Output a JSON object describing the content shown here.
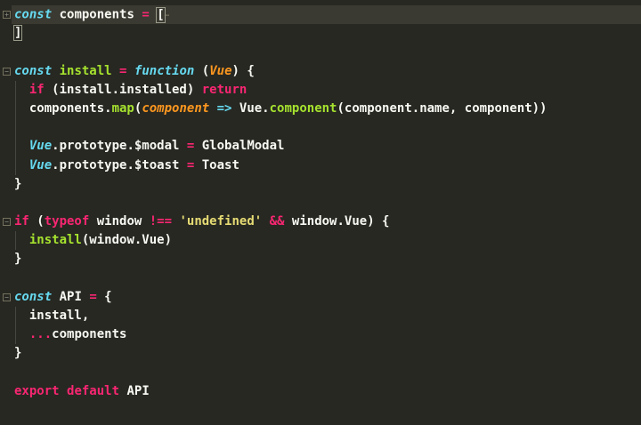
{
  "editor": {
    "lines": [
      {
        "fold": "plus",
        "current": true,
        "tokens": [
          [
            "const",
            "st"
          ],
          [
            " components ",
            ""
          ],
          [
            "=",
            "kw"
          ],
          [
            " ",
            ""
          ],
          [
            "[",
            "br"
          ],
          [
            "…",
            "ell"
          ]
        ]
      },
      {
        "tokens": [
          [
            "]",
            "br"
          ]
        ]
      },
      {
        "tokens": []
      },
      {
        "fold": "minus",
        "tokens": [
          [
            "const",
            "st"
          ],
          [
            " ",
            ""
          ],
          [
            "install",
            "fn"
          ],
          [
            " ",
            ""
          ],
          [
            "=",
            "kw"
          ],
          [
            " ",
            ""
          ],
          [
            "function",
            "st"
          ],
          [
            " (",
            ""
          ],
          [
            "Vue",
            "pa"
          ],
          [
            ") {",
            ""
          ]
        ]
      },
      {
        "guide": true,
        "tokens": [
          [
            "  ",
            ""
          ],
          [
            "if",
            "kw"
          ],
          [
            " (install.installed) ",
            ""
          ],
          [
            "return",
            "kw"
          ]
        ]
      },
      {
        "guide": true,
        "tokens": [
          [
            "  components.",
            ""
          ],
          [
            "map",
            "fn"
          ],
          [
            "(",
            ""
          ],
          [
            "component",
            "pa"
          ],
          [
            " ",
            ""
          ],
          [
            "=>",
            "op2"
          ],
          [
            " Vue.",
            ""
          ],
          [
            "component",
            "fn"
          ],
          [
            "(component.name, component))",
            ""
          ]
        ]
      },
      {
        "guide": true,
        "tokens": []
      },
      {
        "guide": true,
        "tokens": [
          [
            "  ",
            ""
          ],
          [
            "Vue",
            "st"
          ],
          [
            ".prototype.$modal ",
            ""
          ],
          [
            "=",
            "kw"
          ],
          [
            " GlobalModal",
            ""
          ]
        ]
      },
      {
        "guide": true,
        "tokens": [
          [
            "  ",
            ""
          ],
          [
            "Vue",
            "st"
          ],
          [
            ".prototype.$toast ",
            ""
          ],
          [
            "=",
            "kw"
          ],
          [
            " Toast",
            ""
          ]
        ]
      },
      {
        "tokens": [
          [
            "}",
            ""
          ]
        ]
      },
      {
        "tokens": []
      },
      {
        "fold": "minus",
        "tokens": [
          [
            "if",
            "kw"
          ],
          [
            " (",
            ""
          ],
          [
            "typeof",
            "kw"
          ],
          [
            " window ",
            ""
          ],
          [
            "!==",
            "kw"
          ],
          [
            " ",
            ""
          ],
          [
            "'undefined'",
            "str"
          ],
          [
            " ",
            ""
          ],
          [
            "&&",
            "kw"
          ],
          [
            " window.Vue) {",
            ""
          ]
        ]
      },
      {
        "guide": true,
        "tokens": [
          [
            "  ",
            ""
          ],
          [
            "install",
            "fn"
          ],
          [
            "(window.Vue)",
            ""
          ]
        ]
      },
      {
        "tokens": [
          [
            "}",
            ""
          ]
        ]
      },
      {
        "tokens": []
      },
      {
        "fold": "minus",
        "tokens": [
          [
            "const",
            "st"
          ],
          [
            " API ",
            ""
          ],
          [
            "=",
            "kw"
          ],
          [
            " {",
            ""
          ]
        ]
      },
      {
        "guide": true,
        "tokens": [
          [
            "  install,",
            ""
          ]
        ]
      },
      {
        "guide": true,
        "tokens": [
          [
            "  ",
            ""
          ],
          [
            "...",
            "kw"
          ],
          [
            "components",
            ""
          ]
        ]
      },
      {
        "tokens": [
          [
            "}",
            ""
          ]
        ]
      },
      {
        "tokens": []
      },
      {
        "tokens": [
          [
            "export",
            "kw"
          ],
          [
            " ",
            ""
          ],
          [
            "default",
            "kw"
          ],
          [
            " API",
            ""
          ]
        ]
      }
    ]
  },
  "colors": {
    "background": "#272822",
    "keyword": "#f92672",
    "storage": "#66d9ef",
    "function": "#a6e22e",
    "parameter": "#fd971f",
    "string": "#e6db74"
  }
}
